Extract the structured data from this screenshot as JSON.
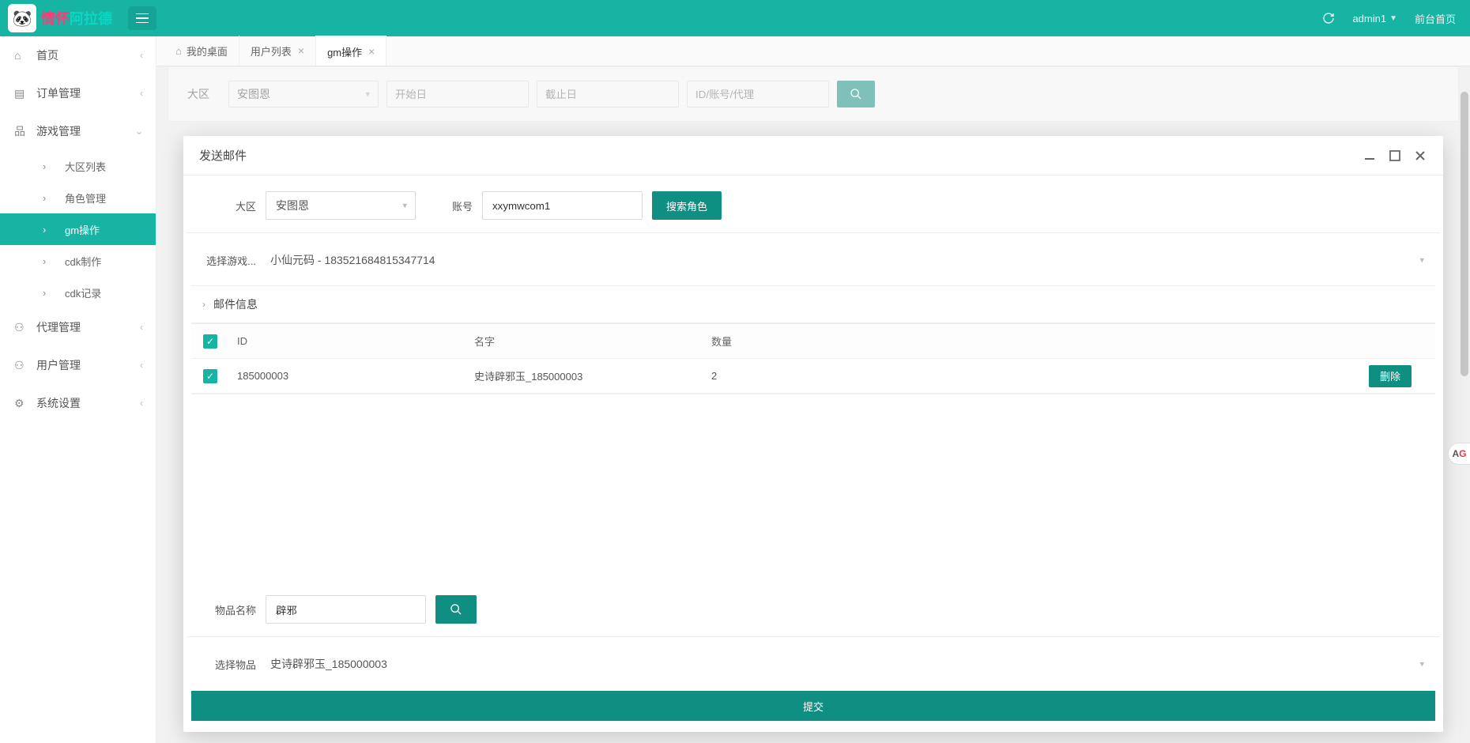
{
  "header": {
    "user": "admin1",
    "front_link": "前台首页"
  },
  "sidebar": {
    "home": "首页",
    "order": "订单管理",
    "game": "游戏管理",
    "game_children": {
      "zone_list": "大区列表",
      "role_mgmt": "角色管理",
      "gm_op": "gm操作",
      "cdk_make": "cdk制作",
      "cdk_record": "cdk记录"
    },
    "agent": "代理管理",
    "user": "用户管理",
    "system": "系统设置"
  },
  "tabs": {
    "desktop": "我的桌面",
    "user_list": "用户列表",
    "gm_op": "gm操作"
  },
  "bg_filter": {
    "zone_label": "大区",
    "zone_value": "安图恩",
    "start_ph": "开始日",
    "end_ph": "截止日",
    "search_ph": "ID/账号/代理"
  },
  "dialog": {
    "title": "发送邮件",
    "zone_label": "大区",
    "zone_value": "安图恩",
    "account_label": "账号",
    "account_value": "xxymwcom1",
    "search_role_btn": "搜索角色",
    "select_game_label": "选择游戏...",
    "select_game_value": "小仙元码 - 183521684815347714",
    "mail_info_header": "邮件信息",
    "table": {
      "headers": {
        "id": "ID",
        "name": "名字",
        "qty": "数量"
      },
      "rows": [
        {
          "id": "185000003",
          "name": "史诗辟邪玉_185000003",
          "qty": "2",
          "delete": "删除"
        }
      ]
    },
    "item_name_label": "物品名称",
    "item_name_value": "辟邪",
    "select_item_label": "选择物品",
    "select_item_value": "史诗辟邪玉_185000003",
    "submit": "提交"
  },
  "badge": "AG"
}
